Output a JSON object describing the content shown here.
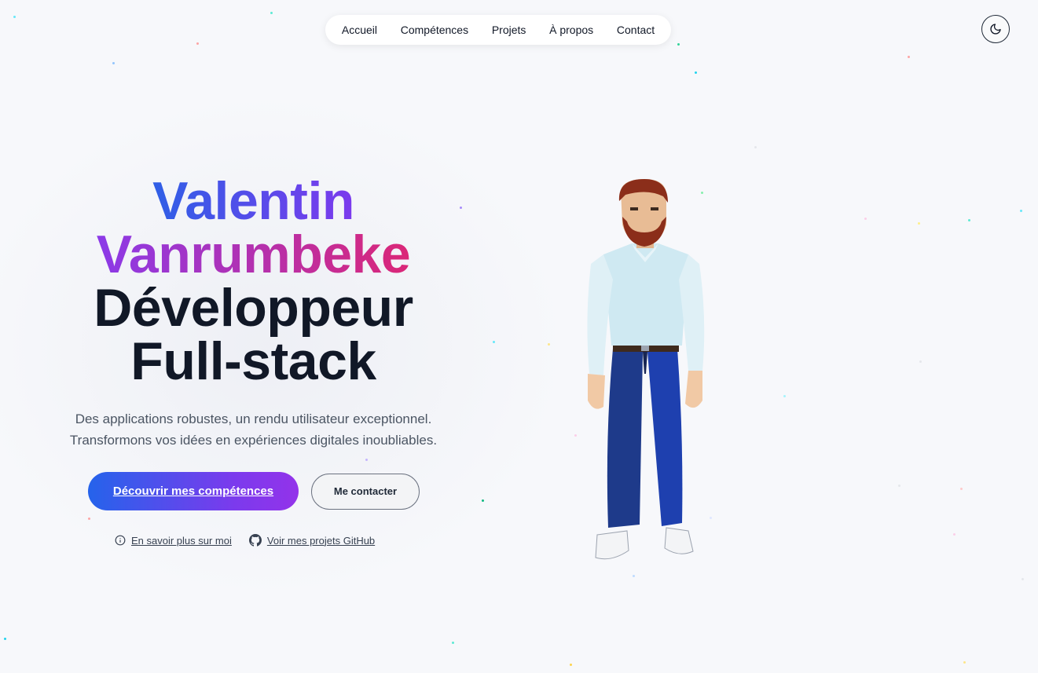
{
  "nav": {
    "items": [
      {
        "label": "Accueil"
      },
      {
        "label": "Compétences"
      },
      {
        "label": "Projets"
      },
      {
        "label": "À propos"
      },
      {
        "label": "Contact"
      }
    ]
  },
  "theme_toggle": {
    "icon": "moon-icon"
  },
  "hero": {
    "first_name": "Valentin",
    "last_name": "Vanrumbeke",
    "role_line1": "Développeur",
    "role_line2": "Full-stack",
    "description_line1": "Des applications robustes, un rendu utilisateur exceptionnel.",
    "description_line2": "Transformons vos idées en expériences digitales inoubliables.",
    "cta_primary": "Découvrir mes compétences",
    "cta_secondary": "Me contacter",
    "link_about": "En savoir plus sur moi",
    "link_github": "Voir mes projets GitHub"
  },
  "colors": {
    "gradient_start": "#2563eb",
    "gradient_mid": "#7c3aed",
    "gradient_end": "#db2777",
    "text_dark": "#111827",
    "background": "#f7f8fb"
  }
}
